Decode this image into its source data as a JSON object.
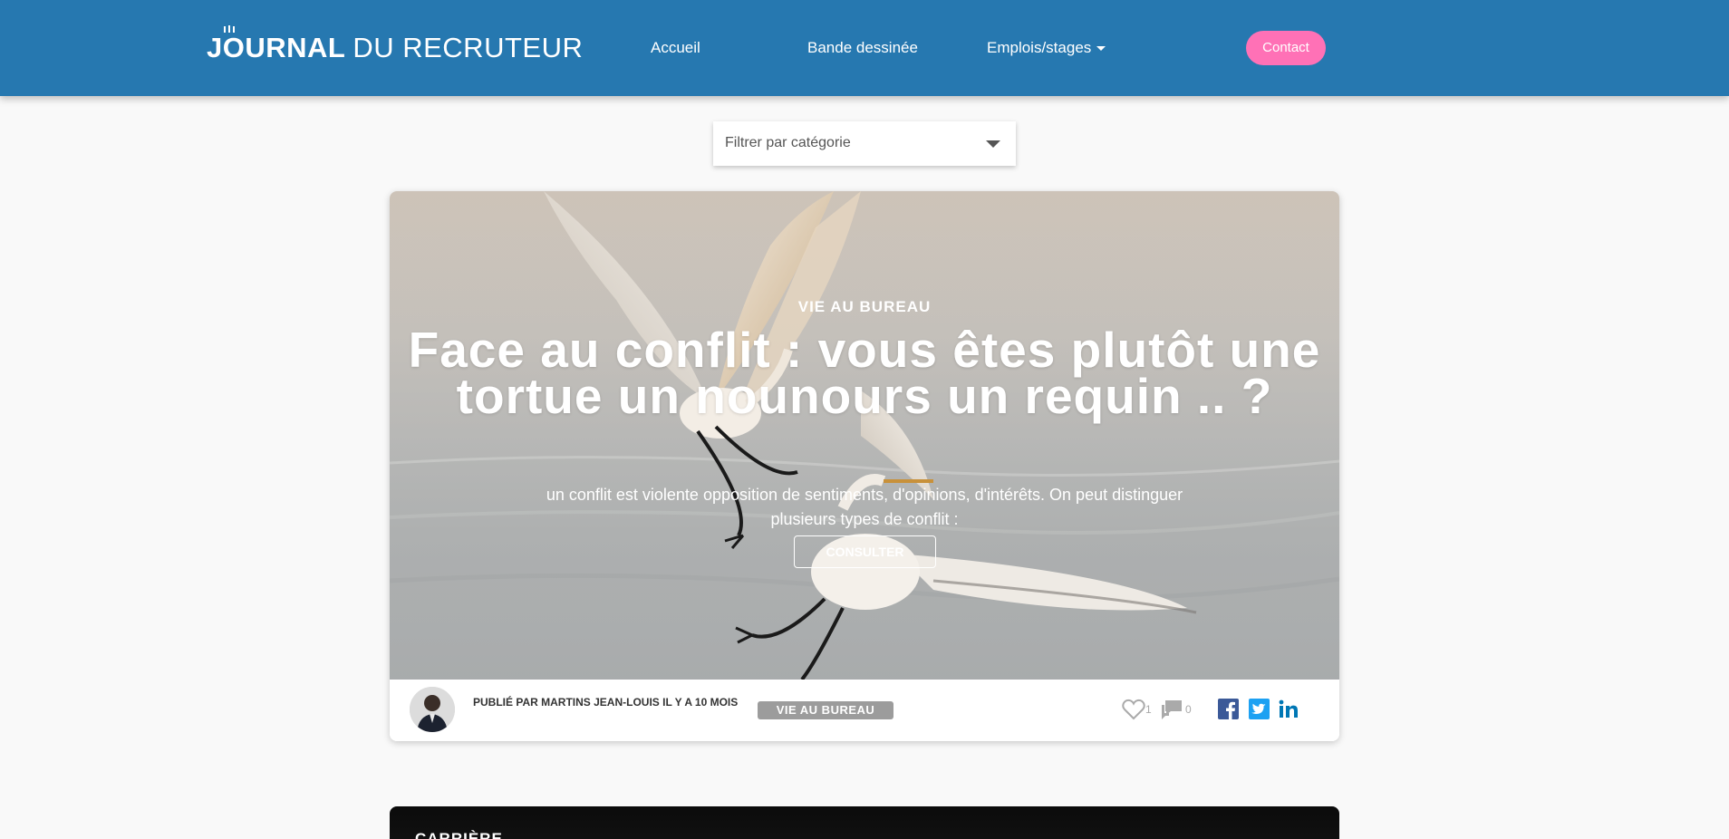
{
  "header": {
    "logo_bold": "JOURNAL",
    "logo_light": "DU RECRUTEUR",
    "nav": [
      {
        "label": "Accueil"
      },
      {
        "label": "Bande dessinée"
      },
      {
        "label": "Emplois/stages"
      }
    ],
    "contact_label": "Contact"
  },
  "filter": {
    "label": "Filtrer par catégorie"
  },
  "articles": [
    {
      "category": "VIE AU BUREAU",
      "title": "Face au conflit : vous êtes plutôt une tortue un nounours un requin .. ?",
      "excerpt": "un conflit est violente opposition de sentiments, d'opinions, d'intérêts. On peut distinguer plusieurs types de conflit :",
      "button_label": "CONSULTER",
      "author_line": "PUBLIÉ PAR MARTINS JEAN-LOUIS IL Y A 10 MOIS",
      "badge": "VIE AU BUREAU",
      "likes": "1",
      "comments": "0"
    },
    {
      "category": "CARRIÈRE"
    }
  ],
  "colors": {
    "header": "#2678b0",
    "contact": "#ff71b6",
    "facebook": "#3b5998",
    "twitter": "#1da1f2",
    "linkedin": "#0077b5"
  },
  "icons": {
    "like": "heart-outline-icon",
    "comments": "chat-bubbles-icon",
    "facebook": "facebook-icon",
    "twitter": "twitter-icon",
    "linkedin": "linkedin-icon"
  }
}
